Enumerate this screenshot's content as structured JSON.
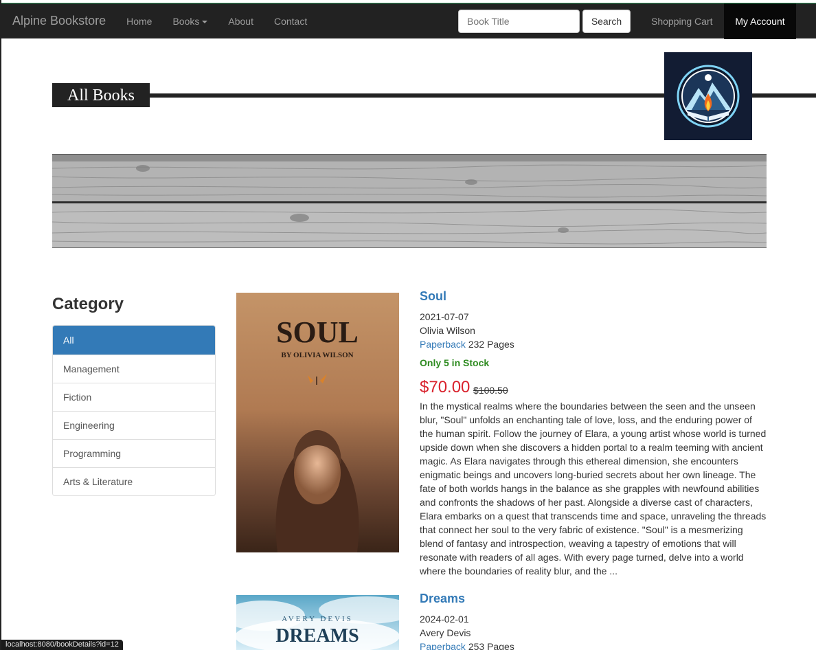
{
  "nav": {
    "brand": "Alpine Bookstore",
    "home": "Home",
    "books": "Books",
    "about": "About",
    "contact": "Contact",
    "search_placeholder": "Book Title",
    "search_button": "Search",
    "cart": "Shopping Cart",
    "account": "My Account"
  },
  "header": {
    "title": "All Books"
  },
  "category": {
    "title": "Category",
    "items": [
      "All",
      "Management",
      "Fiction",
      "Engineering",
      "Programming",
      "Arts & Literature"
    ],
    "active": "All"
  },
  "books": [
    {
      "title": "Soul",
      "cover_title": "SOUL",
      "cover_author": "BY OLIVIA WILSON",
      "date": "2021-07-07",
      "author": "Olivia Wilson",
      "format": "Paperback",
      "pages": "232 Pages",
      "stock": "Only 5 in Stock",
      "price": "$70.00",
      "old_price": "$100.50",
      "description": "In the mystical realms where the boundaries between the seen and the unseen blur, \"Soul\" unfolds an enchanting tale of love, loss, and the enduring power of the human spirit. Follow the journey of Elara, a young artist whose world is turned upside down when she discovers a hidden portal to a realm teeming with ancient magic. As Elara navigates through this ethereal dimension, she encounters enigmatic beings and uncovers long-buried secrets about her own lineage. The fate of both worlds hangs in the balance as she grapples with newfound abilities and confronts the shadows of her past. Alongside a diverse cast of characters, Elara embarks on a quest that transcends time and space, unraveling the threads that connect her soul to the very fabric of existence. \"Soul\" is a mesmerizing blend of fantasy and introspection, weaving a tapestry of emotions that will resonate with readers of all ages. With every page turned, delve into a world where the boundaries of reality blur, and the ..."
    },
    {
      "title": "Dreams",
      "cover_title": "DREAMS",
      "cover_author": "AVERY DEVIS",
      "date": "2024-02-01",
      "author": "Avery Devis",
      "format": "Paperback",
      "pages": "253 Pages"
    }
  ],
  "status_url": "localhost:8080/bookDetails?id=12"
}
